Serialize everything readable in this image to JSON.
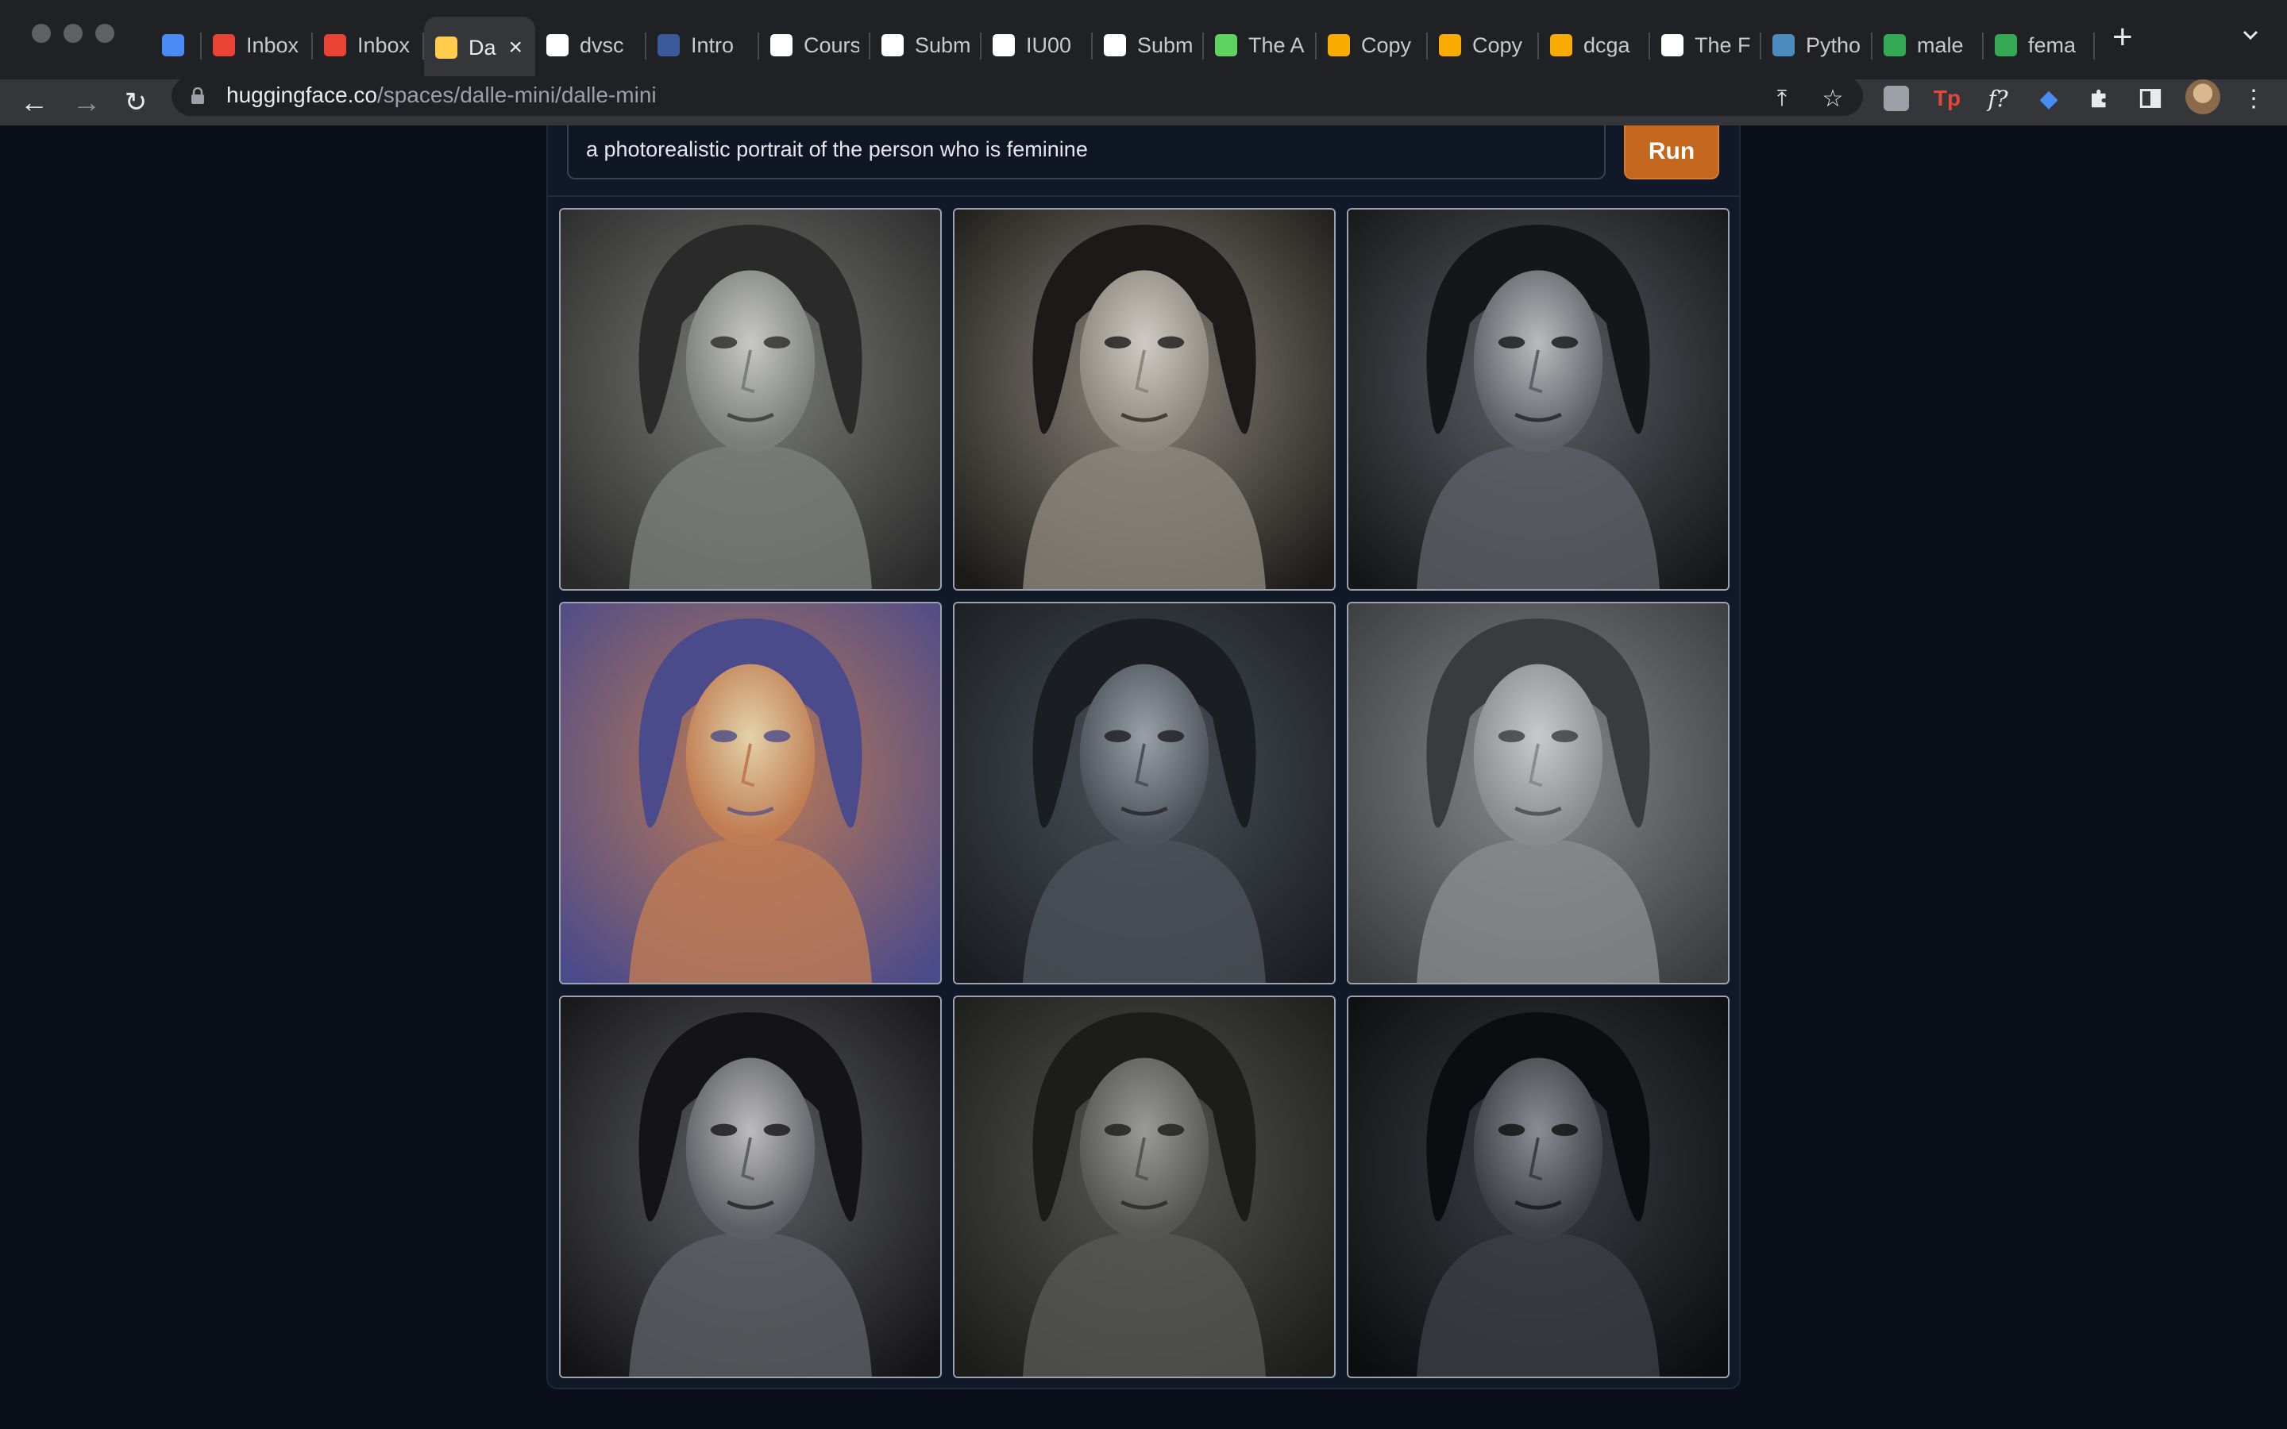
{
  "browser": {
    "tabs": [
      {
        "title": "",
        "icon": "gem-icon",
        "color": "#4a8af4"
      },
      {
        "title": "Inbox",
        "icon": "gmail-icon",
        "color": "#ea4335"
      },
      {
        "title": "Inbox",
        "icon": "gmail-icon",
        "color": "#ea4335"
      },
      {
        "title": "Da",
        "icon": "hugging-face-icon",
        "color": "#ffcc4d",
        "active": true
      },
      {
        "title": "dvsc",
        "icon": "github-icon",
        "color": "#ffffff"
      },
      {
        "title": "Intro",
        "icon": "tds-icon",
        "color": "#3a5a9a"
      },
      {
        "title": "Cours",
        "icon": "dots-icon",
        "color": "#ffffff"
      },
      {
        "title": "Subm",
        "icon": "dots-icon",
        "color": "#ffffff"
      },
      {
        "title": "IU00",
        "icon": "dots-icon",
        "color": "#ffffff"
      },
      {
        "title": "Subm",
        "icon": "dots-icon",
        "color": "#ffffff"
      },
      {
        "title": "The A",
        "icon": "smile-icon",
        "color": "#5fd35f"
      },
      {
        "title": "Copy",
        "icon": "colab-icon",
        "color": "#f9ab00"
      },
      {
        "title": "Copy",
        "icon": "colab-icon",
        "color": "#f9ab00"
      },
      {
        "title": "dcga",
        "icon": "colab-icon",
        "color": "#f9ab00"
      },
      {
        "title": "The F",
        "icon": "paper-icon",
        "color": "#ffffff"
      },
      {
        "title": "Pytho",
        "icon": "python-icon",
        "color": "#4b8bbe"
      },
      {
        "title": "male",
        "icon": "drive-icon",
        "color": "#34a853"
      },
      {
        "title": "fema",
        "icon": "drive-icon",
        "color": "#34a853"
      }
    ],
    "url_host": "huggingface.co",
    "url_path": "/spaces/dalle-mini/dalle-mini"
  },
  "app": {
    "prompt_text": "a photorealistic portrait of the person who is feminine",
    "run_label": "Run",
    "accent": "#c2671d"
  },
  "results": [
    {
      "name": "result-image-1",
      "palette": [
        "#c8c9c4",
        "#7c7e7a",
        "#2a2a2a"
      ]
    },
    {
      "name": "result-image-2",
      "palette": [
        "#cfcbc4",
        "#8d877d",
        "#1c1a18"
      ]
    },
    {
      "name": "result-image-3",
      "palette": [
        "#b9bbbd",
        "#5d6066",
        "#141618"
      ]
    },
    {
      "name": "result-image-4",
      "palette": [
        "#e4d2a8",
        "#c07c52",
        "#4b4a8a"
      ]
    },
    {
      "name": "result-image-5",
      "palette": [
        "#9aa0a8",
        "#4c525a",
        "#1a1d22"
      ]
    },
    {
      "name": "result-image-6",
      "palette": [
        "#c9cacc",
        "#8a8b8d",
        "#3a3b3d"
      ]
    },
    {
      "name": "result-image-7",
      "palette": [
        "#bcbcbe",
        "#5e5f64",
        "#141416"
      ]
    },
    {
      "name": "result-image-8",
      "palette": [
        "#9a9a96",
        "#565652",
        "#1c1c1a"
      ]
    },
    {
      "name": "result-image-9",
      "palette": [
        "#8a8e94",
        "#3c3f44",
        "#0c0d10"
      ]
    }
  ]
}
